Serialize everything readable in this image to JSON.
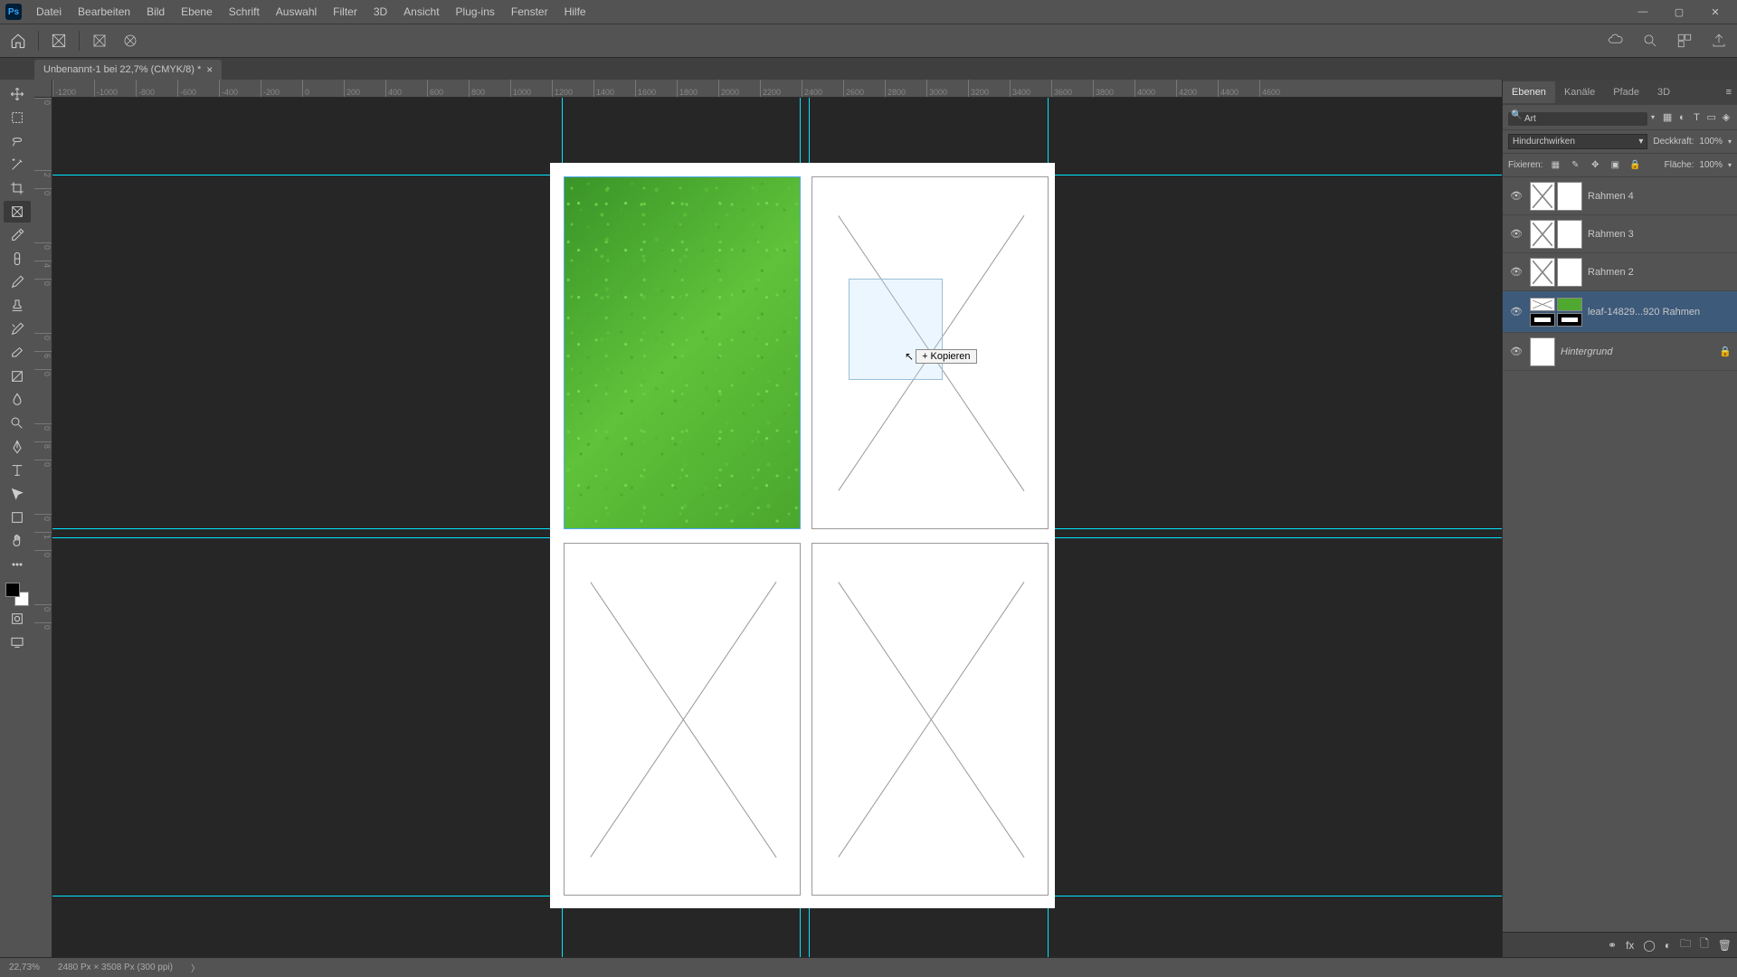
{
  "menus": [
    "Datei",
    "Bearbeiten",
    "Bild",
    "Ebene",
    "Schrift",
    "Auswahl",
    "Filter",
    "3D",
    "Ansicht",
    "Plug-ins",
    "Fenster",
    "Hilfe"
  ],
  "document_tab": "Unbenannt-1 bei 22,7% (CMYK/8) *",
  "ruler_h": [
    "-1200",
    "-1000",
    "-800",
    "-600",
    "-400",
    "-200",
    "0",
    "200",
    "400",
    "600",
    "800",
    "1000",
    "1200",
    "1400",
    "1600",
    "1800",
    "2000",
    "2200",
    "2400",
    "2600",
    "2800",
    "3000",
    "3200",
    "3400",
    "3600",
    "3800",
    "4000",
    "4200",
    "4400",
    "4600"
  ],
  "ruler_v": [
    "0",
    "2",
    "0",
    "0",
    "4",
    "0",
    "0",
    "6",
    "0",
    "0",
    "8",
    "0",
    "0",
    "1",
    "0",
    "0",
    "0"
  ],
  "panel_tabs": [
    "Ebenen",
    "Kanäle",
    "Pfade",
    "3D"
  ],
  "search_placeholder": "Art",
  "blend_mode": "Hindurchwirken",
  "opacity_label": "Deckkraft:",
  "opacity_value": "100%",
  "lock_label": "Fixieren:",
  "fill_label": "Fläche:",
  "fill_value": "100%",
  "layers": [
    {
      "name": "Rahmen 4",
      "selected": false,
      "type": "frame",
      "locked": false
    },
    {
      "name": "Rahmen 3",
      "selected": false,
      "type": "frame",
      "locked": false
    },
    {
      "name": "Rahmen 2",
      "selected": false,
      "type": "frame",
      "locked": false
    },
    {
      "name": "leaf-14829...920 Rahmen",
      "selected": true,
      "type": "image-frame",
      "locked": false
    },
    {
      "name": "Hintergrund",
      "selected": false,
      "type": "bg",
      "locked": true
    }
  ],
  "cursor_tooltip": "Kopieren",
  "status_zoom": "22,73%",
  "status_info": "2480 Px × 3508 Px (300 ppi)"
}
